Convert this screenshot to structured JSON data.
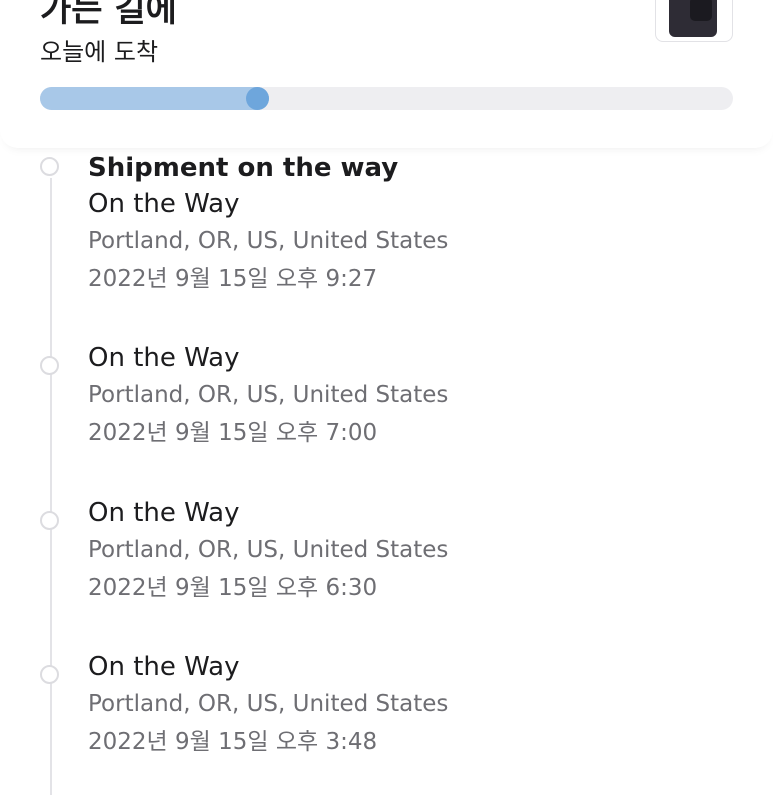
{
  "header": {
    "title": "가는 길에",
    "subtitle": "오늘에 도착",
    "progress_fraction": 0.33,
    "colors": {
      "progress_fill": "#a8c8e8",
      "progress_knob": "#6ea6dc",
      "progress_track": "#eeeef1"
    },
    "product_icon": "phone-thumbnail-icon"
  },
  "events": [
    {
      "heading": "Shipment on the way",
      "status": "On the Way",
      "location": "Portland, OR, US, United States",
      "time": "2022년 9월 15일  오후 9:27"
    },
    {
      "heading": "",
      "status": "On the Way",
      "location": "Portland, OR, US, United States",
      "time": "2022년 9월 15일  오후 7:00"
    },
    {
      "heading": "",
      "status": "On the Way",
      "location": "Portland, OR, US, United States",
      "time": "2022년 9월 15일  오후 6:30"
    },
    {
      "heading": "",
      "status": "On the Way",
      "location": "Portland, OR, US, United States",
      "time": "2022년 9월 15일  오후 3:48"
    }
  ]
}
